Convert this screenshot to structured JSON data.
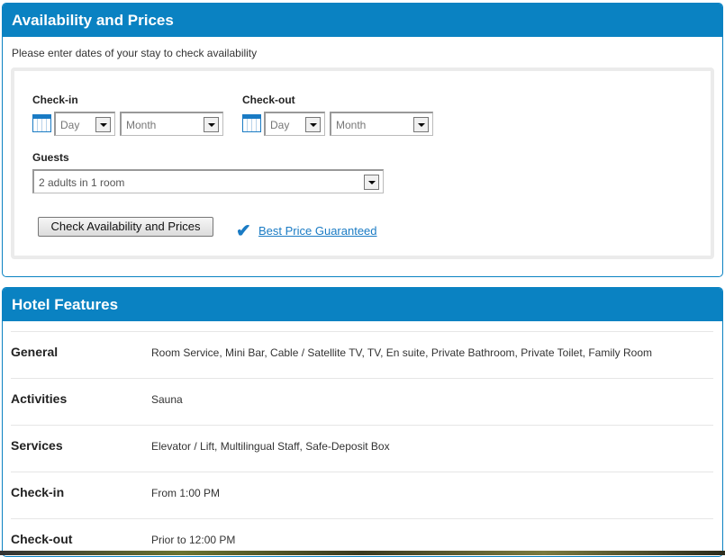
{
  "availability": {
    "title": "Availability and Prices",
    "intro": "Please enter dates of your stay to check availability",
    "checkin_label": "Check-in",
    "checkout_label": "Check-out",
    "day_placeholder": "Day",
    "month_placeholder": "Month",
    "guests_label": "Guests",
    "guests_value": "2 adults in 1 room",
    "submit_label": "Check Availability and Prices",
    "best_price_link": "Best Price Guaranteed",
    "accent_color": "#0a82c2"
  },
  "features": {
    "title": "Hotel Features",
    "rows": [
      {
        "label": "General",
        "value": "Room Service, Mini Bar, Cable / Satellite TV, TV, En suite, Private Bathroom, Private Toilet, Family Room"
      },
      {
        "label": "Activities",
        "value": "Sauna"
      },
      {
        "label": "Services",
        "value": "Elevator / Lift, Multilingual Staff, Safe-Deposit Box"
      },
      {
        "label": "Check-in",
        "value": "From 1:00 PM"
      },
      {
        "label": "Check-out",
        "value": "Prior to 12:00 PM"
      }
    ]
  }
}
